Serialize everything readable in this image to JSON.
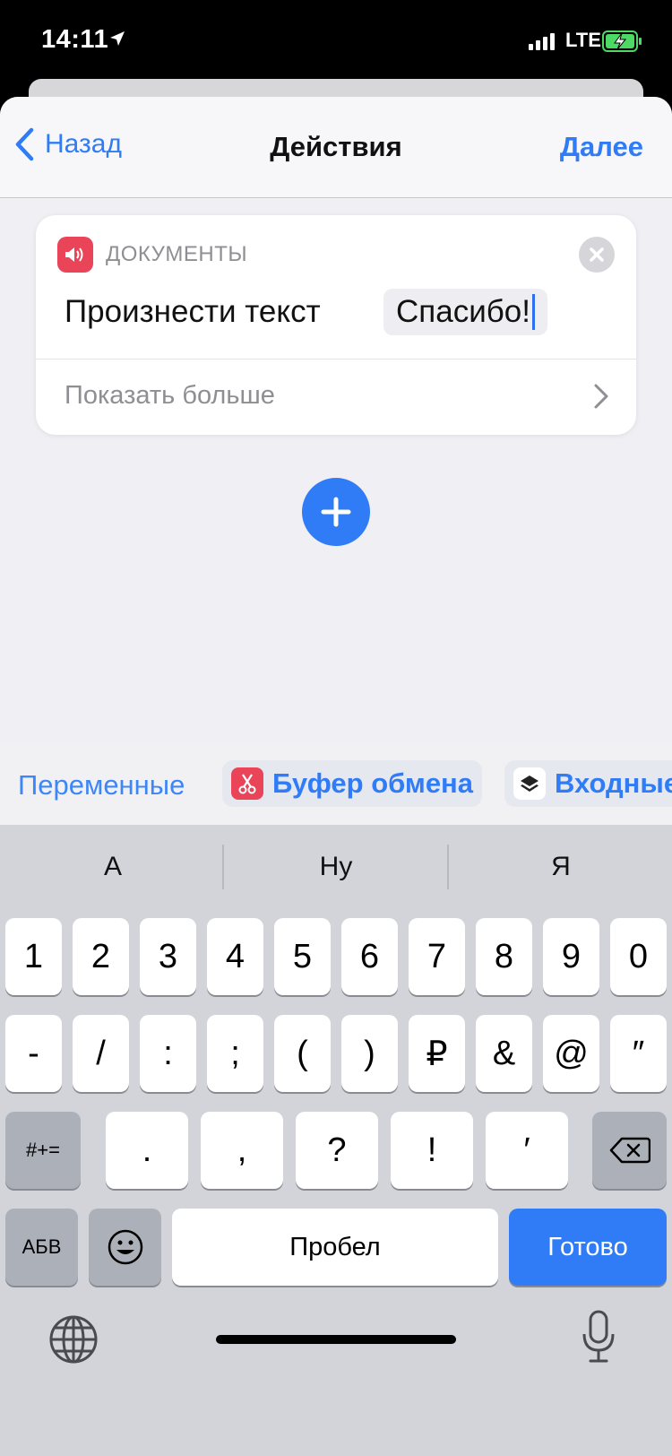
{
  "status": {
    "time": "14:11",
    "network": "LTE"
  },
  "nav": {
    "back_label": "Назад",
    "title": "Действия",
    "next_label": "Далее"
  },
  "card": {
    "category": "ДОКУМЕНТЫ",
    "action": "Произнести текст",
    "param_value": "Спасибо!",
    "show_more": "Показать больше",
    "icon_color": "#ea4459"
  },
  "variables": {
    "label": "Переменные",
    "chips": [
      {
        "label": "Буфер обмена",
        "icon": "scissors-icon",
        "icon_color": "#ea4459"
      },
      {
        "label": "Входные",
        "icon": "layers-icon",
        "icon_color": "#ffffff"
      }
    ]
  },
  "suggestions": [
    "А",
    "Ну",
    "Я"
  ],
  "keys": {
    "row1": [
      "1",
      "2",
      "3",
      "4",
      "5",
      "6",
      "7",
      "8",
      "9",
      "0"
    ],
    "row2": [
      "-",
      "/",
      ":",
      ";",
      "(",
      ")",
      "₽",
      "&",
      "@",
      "″"
    ],
    "row3_mode": "#+=",
    "row3": [
      ".",
      ",",
      "?",
      "!",
      "′"
    ],
    "row4_mode": "АБВ",
    "space": "Пробел",
    "done": "Готово"
  },
  "colors": {
    "accent": "#2f7cf6",
    "battery": "#4cd964"
  }
}
